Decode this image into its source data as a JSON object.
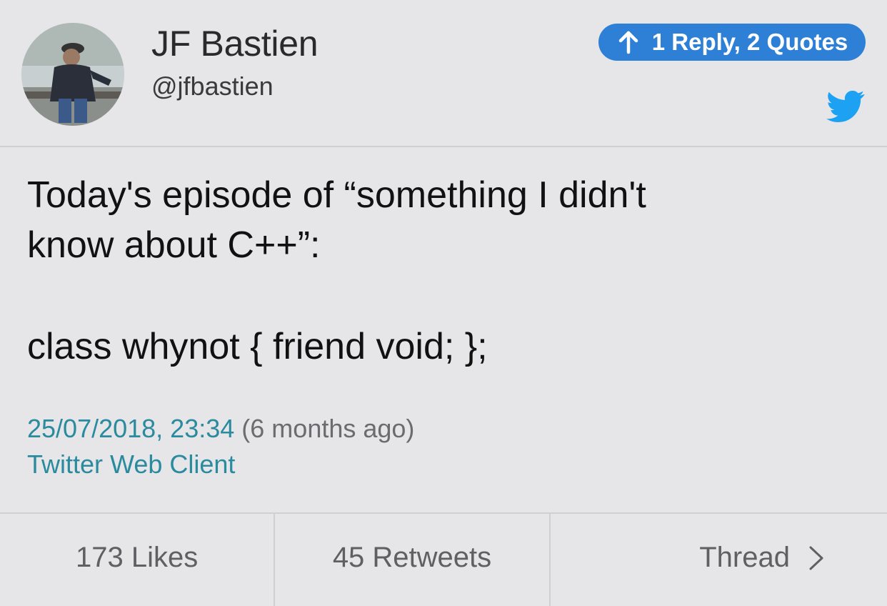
{
  "author": {
    "display_name": "JF Bastien",
    "handle": "@jfbastien"
  },
  "reply_badge": {
    "label": "1 Reply, 2 Quotes",
    "icon": "arrow-up-icon"
  },
  "brand_icon": "twitter-bird-icon",
  "tweet": {
    "text": "Today's episode of “something I didn't\nknow about C++”:",
    "code": "class whynot { friend void; };"
  },
  "meta": {
    "date": "25/07/2018, 23:34",
    "relative": "(6 months ago)",
    "client": "Twitter Web Client"
  },
  "footer": {
    "likes": "173 Likes",
    "retweets": "45 Retweets",
    "thread": "Thread"
  },
  "colors": {
    "background": "#e6e6e9",
    "accent_blue": "#2e7fd6",
    "link_teal": "#2a8a9e",
    "twitter_blue": "#1da1f2"
  }
}
